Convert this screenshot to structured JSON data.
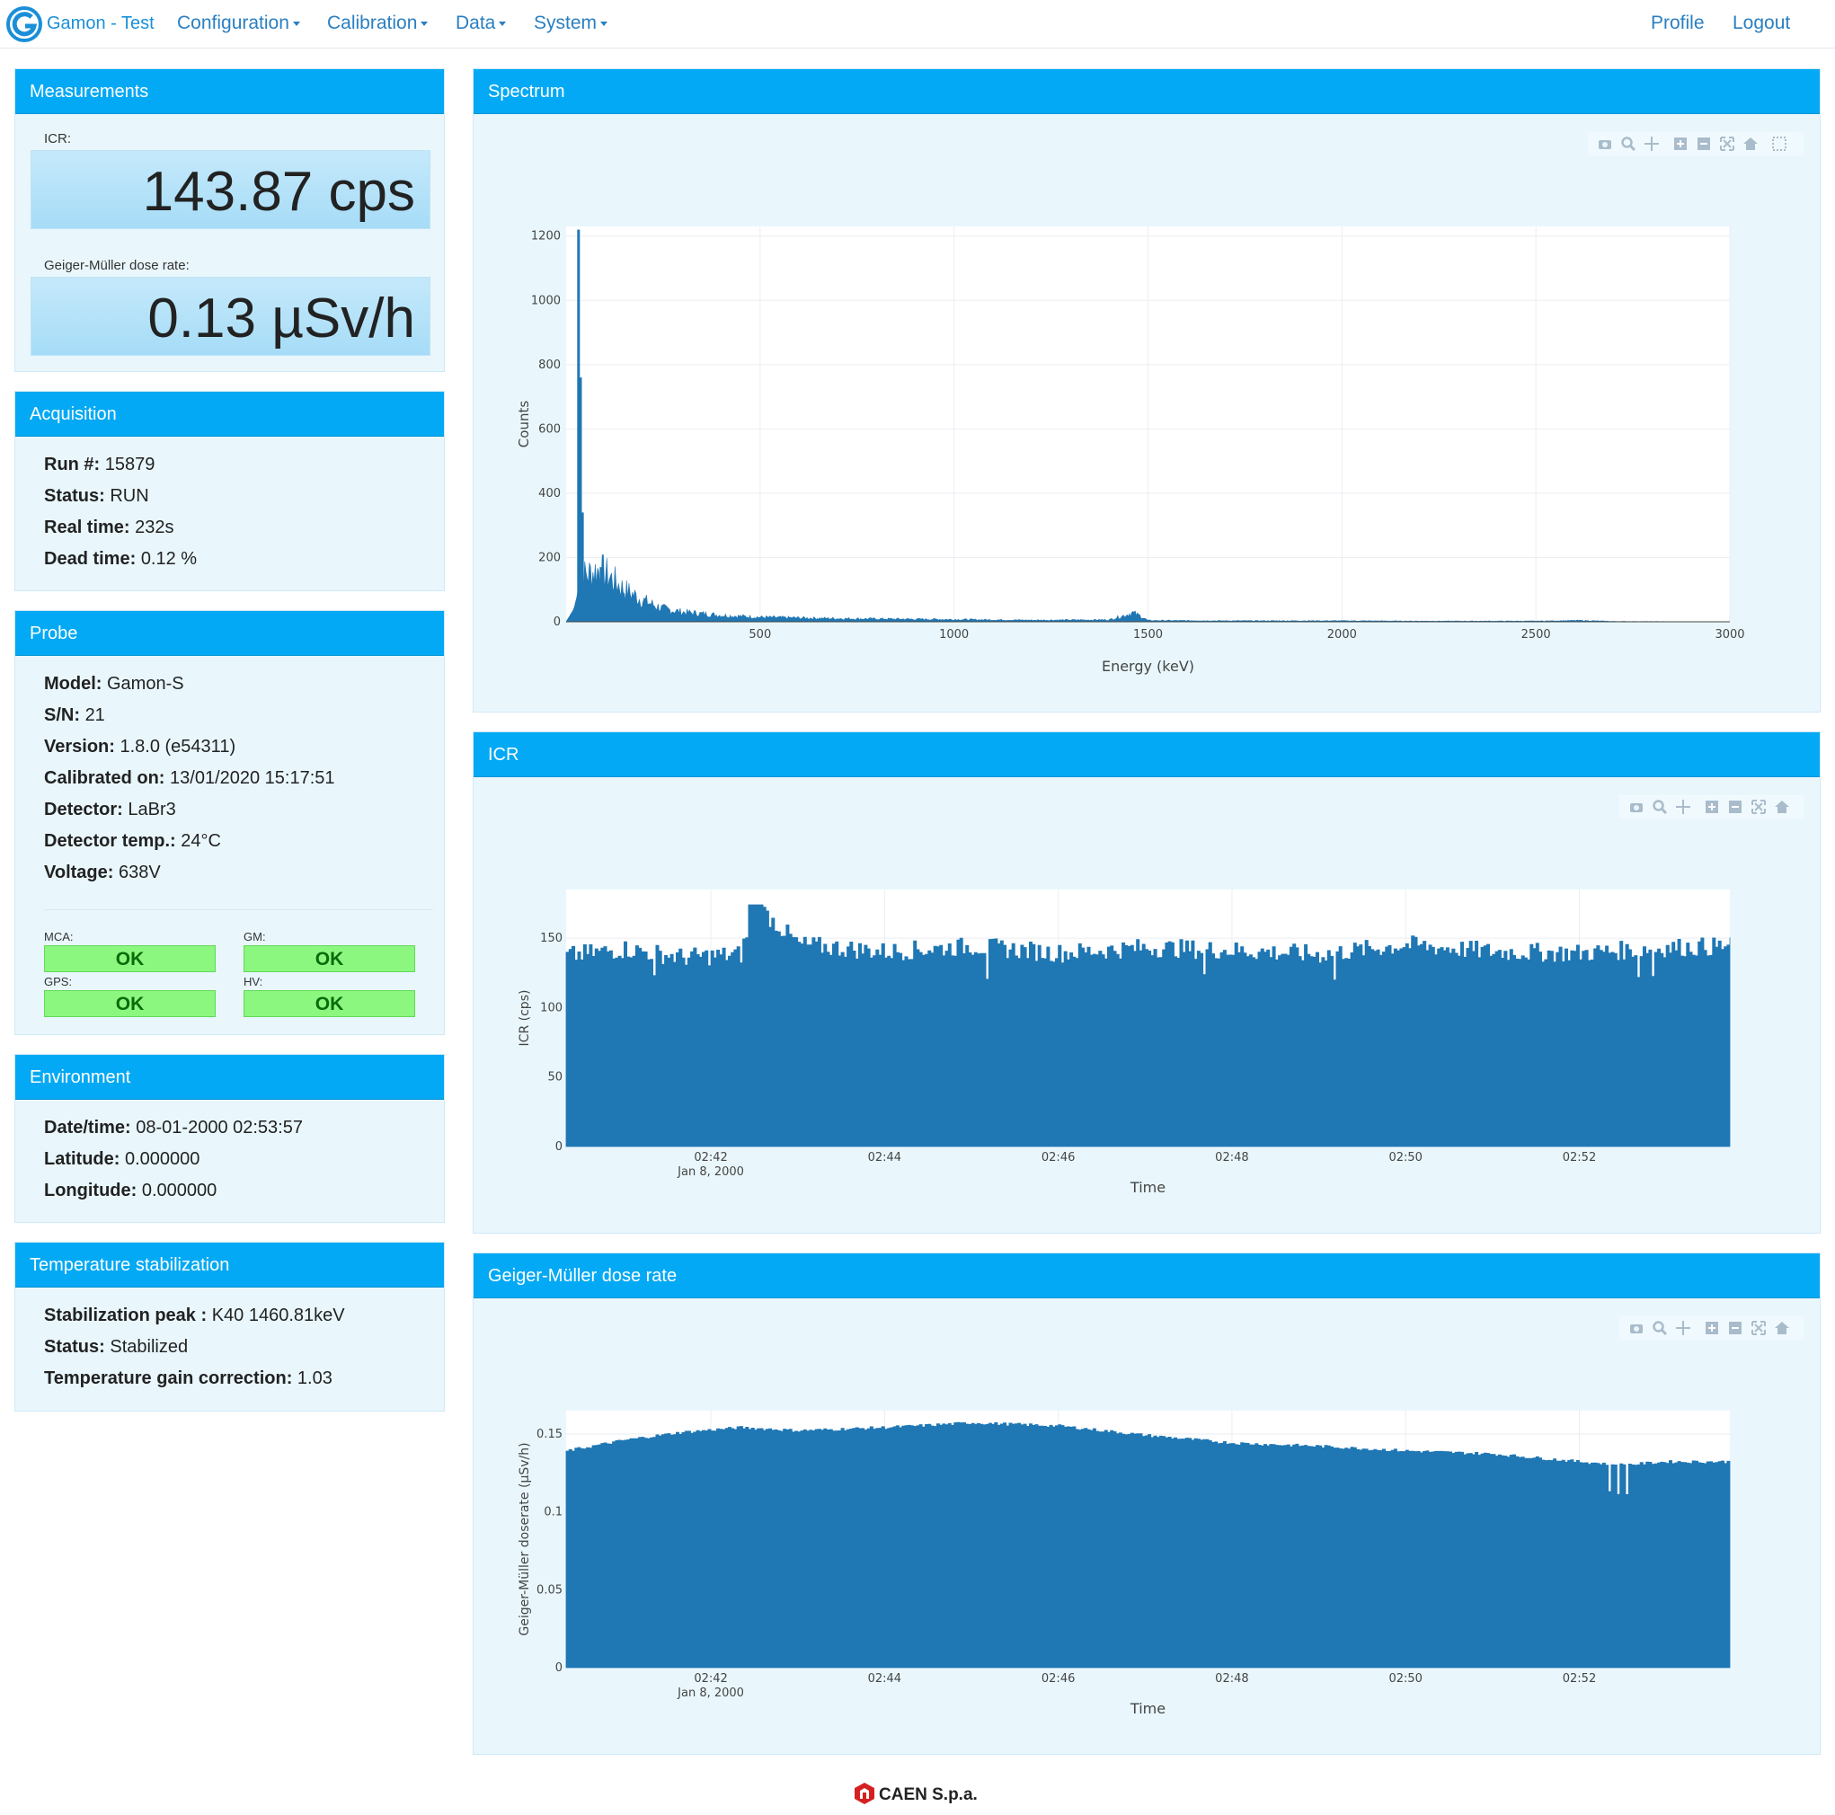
{
  "nav": {
    "brand": "Gamon - Test",
    "menus": [
      "Configuration",
      "Calibration",
      "Data",
      "System"
    ],
    "right": [
      "Profile",
      "Logout"
    ]
  },
  "measurements": {
    "title": "Measurements",
    "icr_label": "ICR:",
    "icr_value": "143.87 cps",
    "gm_label": "Geiger-Müller dose rate:",
    "gm_value": "0.13 µSv/h"
  },
  "acquisition": {
    "title": "Acquisition",
    "rows": [
      {
        "k": "Run #:",
        "v": "15879"
      },
      {
        "k": "Status:",
        "v": "RUN"
      },
      {
        "k": "Real time:",
        "v": "232s"
      },
      {
        "k": "Dead time:",
        "v": "0.12 %"
      }
    ]
  },
  "probe": {
    "title": "Probe",
    "rows": [
      {
        "k": "Model:",
        "v": "Gamon-S"
      },
      {
        "k": "S/N:",
        "v": "21"
      },
      {
        "k": "Version:",
        "v": "1.8.0 (e54311)"
      },
      {
        "k": "Calibrated on:",
        "v": "13/01/2020 15:17:51"
      },
      {
        "k": "Detector:",
        "v": "LaBr3"
      },
      {
        "k": "Detector temp.:",
        "v": "24°C"
      },
      {
        "k": "Voltage:",
        "v": "638V"
      }
    ],
    "status": [
      {
        "label": "MCA:",
        "value": "OK"
      },
      {
        "label": "GM:",
        "value": "OK"
      },
      {
        "label": "GPS:",
        "value": "OK"
      },
      {
        "label": "HV:",
        "value": "OK"
      }
    ]
  },
  "environment": {
    "title": "Environment",
    "rows": [
      {
        "k": "Date/time:",
        "v": "08-01-2000 02:53:57"
      },
      {
        "k": "Latitude:",
        "v": "0.000000"
      },
      {
        "k": "Longitude:",
        "v": "0.000000"
      }
    ]
  },
  "temp_stab": {
    "title": "Temperature stabilization",
    "rows": [
      {
        "k": "Stabilization peak :",
        "v": "K40 1460.81keV"
      },
      {
        "k": "Status:",
        "v": "Stabilized"
      },
      {
        "k": "Temperature gain correction:",
        "v": "1.03"
      }
    ]
  },
  "panels": {
    "spectrum": "Spectrum",
    "icr": "ICR",
    "gm": "Geiger-Müller dose rate"
  },
  "footer": "CAEN S.p.a.",
  "colors": {
    "accent": "#03a9f4",
    "series": "#1f77b4",
    "ok": "#8cf77f"
  },
  "chart_data": [
    {
      "type": "bar",
      "xlabel": "Energy (keV)",
      "ylabel": "Counts",
      "xlim": [
        0,
        3000
      ],
      "ylim": [
        0,
        1230
      ],
      "xticks": [
        500,
        1000,
        1500,
        2000,
        2500,
        3000
      ],
      "yticks": [
        0,
        200,
        400,
        600,
        800,
        1000,
        1200
      ],
      "grid": true,
      "peaks": [
        {
          "x": 32,
          "y": 1220
        },
        {
          "x": 37,
          "y": 760
        },
        {
          "x": 42,
          "y": 340
        },
        {
          "x": 90,
          "y": 170
        },
        {
          "x": 1460,
          "y": 28
        }
      ],
      "series": [
        {
          "x": [
            0,
            20,
            40,
            60,
            80,
            100,
            120,
            150,
            200,
            250,
            300,
            400,
            500,
            700,
            900,
            1000,
            1200,
            1400,
            1440,
            1460,
            1480,
            1500,
            1700,
            2000,
            2200,
            2500,
            2615,
            2700,
            3000
          ],
          "y": [
            0,
            40,
            140,
            150,
            160,
            150,
            130,
            100,
            65,
            40,
            30,
            20,
            14,
            10,
            8,
            7,
            5,
            6,
            20,
            28,
            18,
            4,
            3,
            3,
            2,
            2,
            4,
            1,
            0
          ]
        }
      ]
    },
    {
      "type": "area",
      "xlabel": "Time",
      "ylabel": "ICR (cps)",
      "xlim": [
        "2000-01-08 02:40:20",
        "2000-01-08 02:53:44"
      ],
      "ylim": [
        0,
        185
      ],
      "xticks": [
        "02:42",
        "02:44",
        "02:46",
        "02:48",
        "02:50",
        "02:52"
      ],
      "xtick_sublabel": "Jan 8, 2000",
      "yticks": [
        0,
        50,
        100,
        150
      ],
      "grid": true,
      "series": [
        {
          "x": [
            "02:40:20",
            "02:41:00",
            "02:41:40",
            "02:42:20",
            "02:42:30",
            "02:43:00",
            "02:44:00",
            "02:45:00",
            "02:46:00",
            "02:47:00",
            "02:48:00",
            "02:49:00",
            "02:50:00",
            "02:51:00",
            "02:52:00",
            "02:53:00",
            "02:53:44"
          ],
          "y": [
            137,
            142,
            136,
            138,
            174,
            145,
            140,
            144,
            139,
            143,
            141,
            138,
            145,
            140,
            139,
            143,
            144
          ]
        }
      ]
    },
    {
      "type": "area",
      "xlabel": "Time",
      "ylabel": "Geiger-Müller doserate (µSv/h)",
      "xlim": [
        "2000-01-08 02:40:20",
        "2000-01-08 02:53:44"
      ],
      "ylim": [
        0,
        0.165
      ],
      "xticks": [
        "02:42",
        "02:44",
        "02:46",
        "02:48",
        "02:50",
        "02:52"
      ],
      "xtick_sublabel": "Jan 8, 2000",
      "yticks": [
        0,
        0.05,
        0.1,
        0.15
      ],
      "ytick_labels": [
        "0",
        "0.05",
        "0.1",
        "0.15"
      ],
      "grid": true,
      "series": [
        {
          "x": [
            "02:40:20",
            "02:41:00",
            "02:41:40",
            "02:42:20",
            "02:43:00",
            "02:44:00",
            "02:45:00",
            "02:46:00",
            "02:47:00",
            "02:48:00",
            "02:49:00",
            "02:50:00",
            "02:51:00",
            "02:52:00",
            "02:52:30",
            "02:53:00",
            "02:53:44"
          ],
          "y": [
            0.139,
            0.146,
            0.151,
            0.154,
            0.152,
            0.154,
            0.157,
            0.155,
            0.149,
            0.144,
            0.142,
            0.139,
            0.137,
            0.132,
            0.13,
            0.132,
            0.132
          ]
        }
      ]
    }
  ]
}
